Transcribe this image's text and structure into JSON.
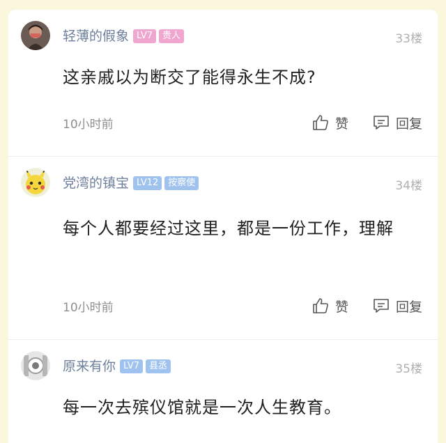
{
  "comments": [
    {
      "username": "轻薄的假象",
      "level": "LV7",
      "title": "贵人",
      "level_color": "#f0a6cf",
      "title_color": "#f0a6cf",
      "floor": "33楼",
      "content": "这亲戚以为断交了能得永生不成?",
      "time": "10小时前",
      "like_label": "赞",
      "reply_label": "回复"
    },
    {
      "username": "党湾的镇宝",
      "level": "LV12",
      "title": "按察使",
      "level_color": "#9fc3ee",
      "title_color": "#9fc3ee",
      "floor": "34楼",
      "content": "每个人都要经过这里，都是一份工作，理解",
      "time": "10小时前",
      "like_label": "赞",
      "reply_label": "回复"
    },
    {
      "username": "原来有你",
      "level": "LV7",
      "title": "县丞",
      "level_color": "#9fc3ee",
      "title_color": "#9fc3ee",
      "floor": "35楼",
      "content": "每一次去殡仪馆就是一次人生教育。"
    }
  ],
  "icons": {
    "like": "thumbs-up-icon",
    "reply": "comment-bubble-icon"
  }
}
